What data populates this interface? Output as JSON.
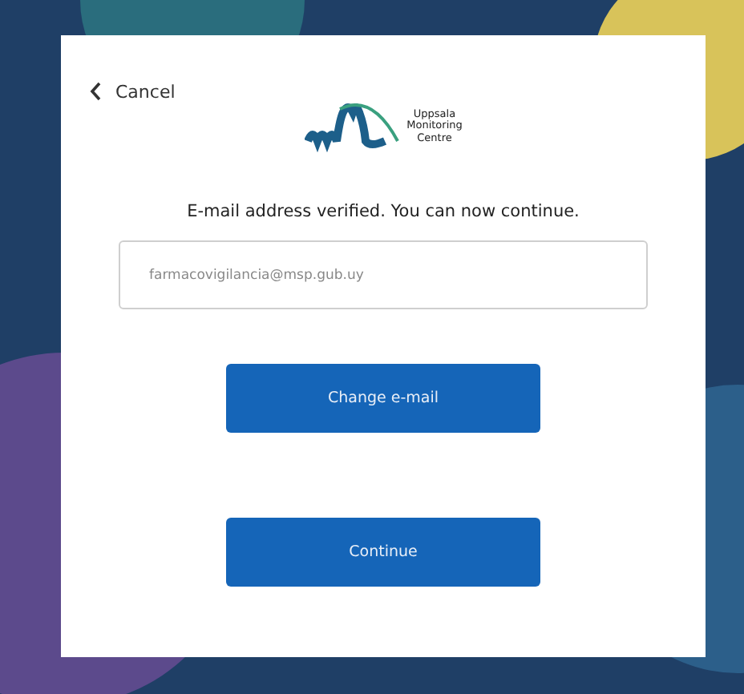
{
  "cancel_link": {
    "label": "Cancel"
  },
  "logo": {
    "lines": [
      "Uppsala",
      "Monitoring",
      "Centre"
    ]
  },
  "message": "E-mail address verified. You can now continue.",
  "email_field": {
    "value": "farmacovigilancia@msp.gub.uy"
  },
  "buttons": [
    "Change e-mail",
    "Continue"
  ]
}
